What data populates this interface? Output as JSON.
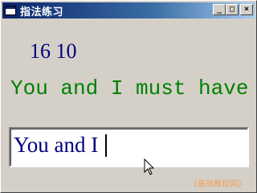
{
  "window": {
    "title": "指法练习",
    "buttons": {
      "minimize": "_",
      "maximize": "□",
      "close": "×"
    }
  },
  "numbers_display": "16 10",
  "target_sentence": "You and I must have",
  "input": {
    "value": "You and I "
  },
  "watermark": "《基础教程网》",
  "colors": {
    "numbers": "#000080",
    "sentence": "#008000",
    "input_text": "#000080",
    "watermark": "#f0a060",
    "title_bar": "#0a246a"
  },
  "icons": {
    "app": "window-app-icon",
    "pointer": "mouse-arrow-cursor"
  }
}
